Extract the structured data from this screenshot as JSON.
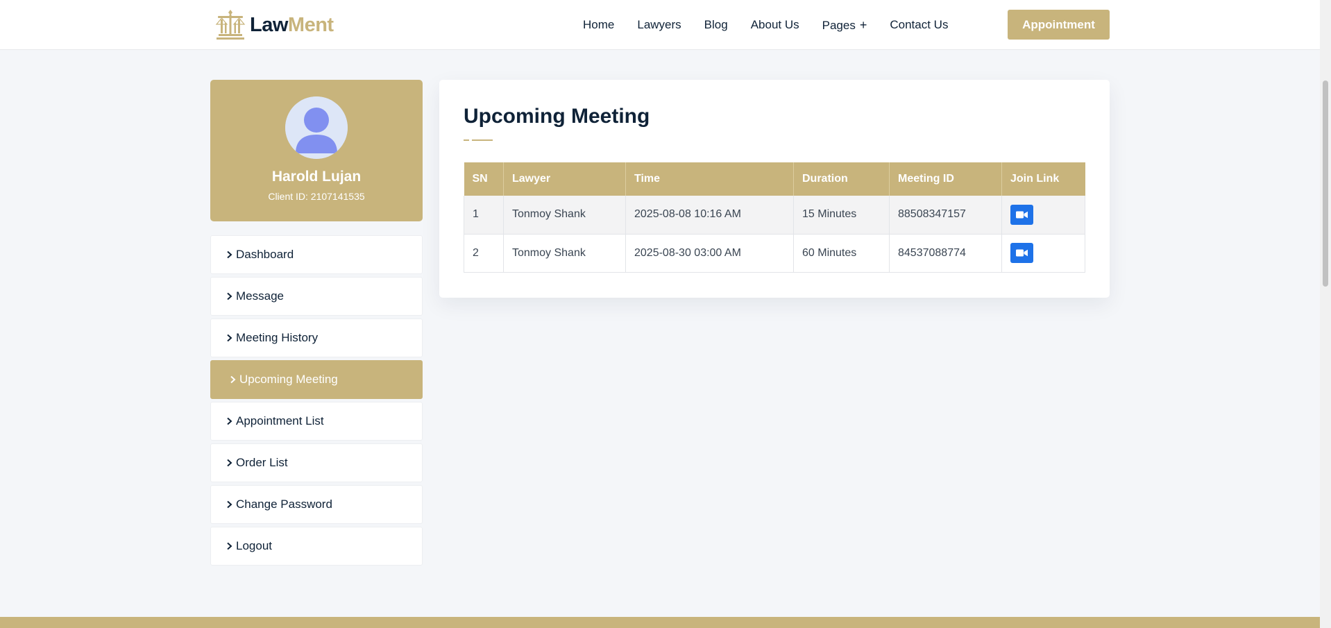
{
  "header": {
    "logo": {
      "part1": "Law",
      "part2": "Ment"
    },
    "nav": [
      {
        "label": "Home"
      },
      {
        "label": "Lawyers"
      },
      {
        "label": "Blog"
      },
      {
        "label": "About Us"
      },
      {
        "label": "Pages",
        "icon": "plus-icon"
      },
      {
        "label": "Contact Us"
      }
    ],
    "appointment_label": "Appointment"
  },
  "profile": {
    "name": "Harold Lujan",
    "client_id": "Client ID: 2107141535"
  },
  "menu": [
    {
      "label": "Dashboard",
      "active": false
    },
    {
      "label": "Message",
      "active": false
    },
    {
      "label": "Meeting History",
      "active": false
    },
    {
      "label": "Upcoming Meeting",
      "active": true
    },
    {
      "label": "Appointment List",
      "active": false
    },
    {
      "label": "Order List",
      "active": false
    },
    {
      "label": "Change Password",
      "active": false
    },
    {
      "label": "Logout",
      "active": false
    }
  ],
  "main": {
    "title": "Upcoming Meeting",
    "columns": [
      "SN",
      "Lawyer",
      "Time",
      "Duration",
      "Meeting ID",
      "Join Link"
    ],
    "rows": [
      {
        "sn": "1",
        "lawyer": "Tonmoy Shank",
        "time": "2025-08-08 10:16 AM",
        "duration": "15 Minutes",
        "meeting_id": "88508347157",
        "join_icon": "video-camera-icon"
      },
      {
        "sn": "2",
        "lawyer": "Tonmoy Shank",
        "time": "2025-08-30 03:00 AM",
        "duration": "60 Minutes",
        "meeting_id": "84537088774",
        "join_icon": "video-camera-icon"
      }
    ]
  },
  "colors": {
    "accent": "#c8b47c",
    "navy": "#0f2237",
    "join_button": "#1e72e8",
    "page_bg": "#f4f6f9"
  }
}
